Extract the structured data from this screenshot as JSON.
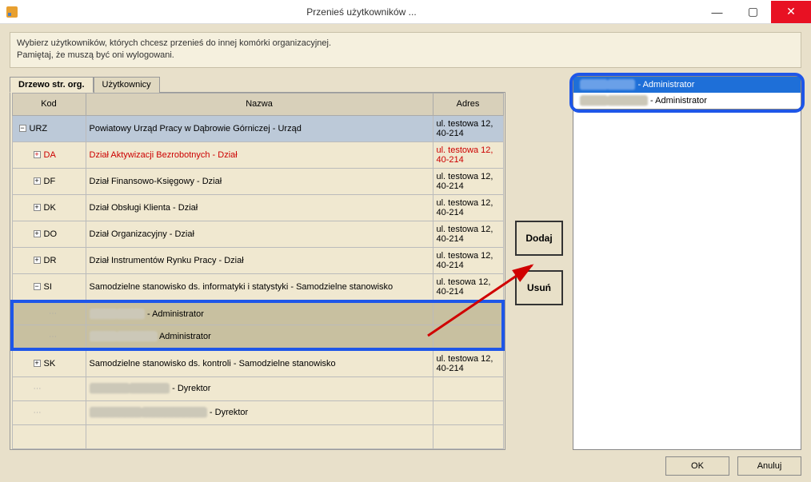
{
  "window": {
    "title": "Przenieś użytkowników ..."
  },
  "instructions": {
    "line1": "Wybierz użytkowników, których chcesz przenieś do innej komórki organizacyjnej.",
    "line2": "Pamiętaj, że muszą być oni wylogowani."
  },
  "tabs": {
    "active": "Drzewo str. org.",
    "other": "Użytkownicy"
  },
  "columns": {
    "kod": "Kod",
    "nazwa": "Nazwa",
    "adres": "Adres"
  },
  "addr": "ul. testowa 12, 40-214",
  "addr_si": "ul. tesowa 12, 40-214",
  "rows": {
    "urz": {
      "kod": "URZ",
      "nazwa": "Powiatowy Urząd Pracy w Dąbrowie Górniczej - Urząd"
    },
    "da": {
      "kod": "DA",
      "nazwa": "Dział Aktywizacji Bezrobotnych - Dział"
    },
    "df": {
      "kod": "DF",
      "nazwa": "Dział Finansowo-Księgowy - Dział"
    },
    "dk": {
      "kod": "DK",
      "nazwa": "Dział Obsługi Klienta - Dział"
    },
    "do": {
      "kod": "DO",
      "nazwa": "Dział Organizacyjny - Dział"
    },
    "dr": {
      "kod": "DR",
      "nazwa": "Dział Instrumentów Rynku Pracy - Dział"
    },
    "si": {
      "kod": "SI",
      "nazwa": "Samodzielne stanowisko ds. informatyki i statystyki - Samodzielne stanowisko"
    },
    "admin_suffix": " - Administrator",
    "admin_suffix2": "  Administrator",
    "sk": {
      "kod": "SK",
      "nazwa": "Samodzielne stanowisko ds. kontroli - Samodzielne stanowisko"
    },
    "dyr_suffix": " - Dyrektor"
  },
  "buttons": {
    "add": "Dodaj",
    "remove": "Usuń",
    "ok": "OK",
    "cancel": "Anuluj"
  },
  "selected": {
    "row1_suffix": " - Administrator",
    "row2_suffix": " - Administrator"
  }
}
